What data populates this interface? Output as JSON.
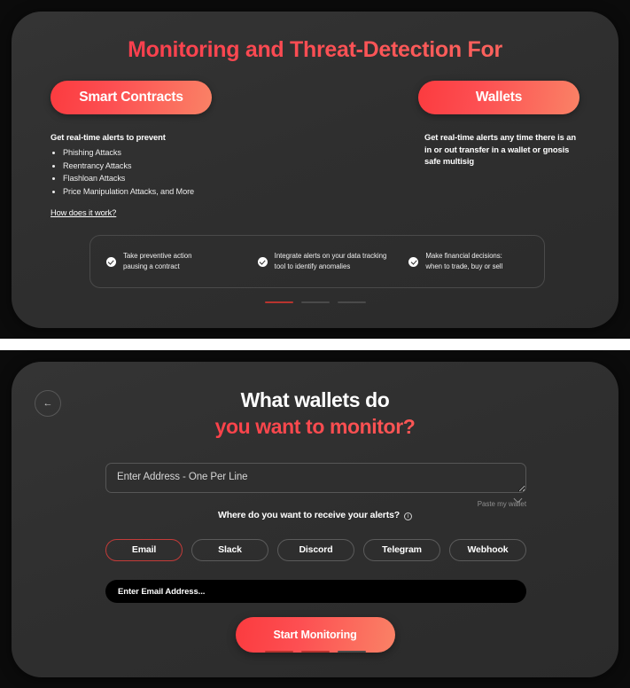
{
  "panel1": {
    "hero_title": "Monitoring and Threat-Detection For",
    "columns": [
      {
        "button_label": "Smart Contracts",
        "lead": "Get real-time alerts to prevent",
        "bullets": [
          "Phishing Attacks",
          "Reentrancy Attacks",
          "Flashloan Attacks",
          "Price Manipulation Attacks, and More"
        ],
        "link_label": "How does it work?"
      },
      {
        "button_label": "Wallets",
        "lead": "Get real-time alerts any time there is an in or out transfer in a wallet or gnosis safe multisig"
      }
    ],
    "features": [
      {
        "icon": "check-circle-icon",
        "line1": "Take preventive action",
        "line2": "pausing a contract"
      },
      {
        "icon": "check-circle-icon",
        "line1": "Integrate alerts on your data tracking",
        "line2": "tool to identify anomalies"
      },
      {
        "icon": "check-circle-icon",
        "line1": "Make financial decisions:",
        "line2": "when to trade, buy or sell"
      }
    ],
    "pagination": {
      "total": 3,
      "active_index": 0
    }
  },
  "panel2": {
    "back_icon": "arrow-left-icon",
    "back_glyph": "←",
    "title_line1": "What wallets do",
    "title_line2": "you want to monitor?",
    "address_placeholder": "Enter Address - One Per Line",
    "address_value": "",
    "paste_link": "Paste my wallet",
    "alerts_question": "Where do you want to receive your alerts?",
    "info_icon": "info-circle-icon",
    "info_glyph": "i",
    "channels": [
      {
        "label": "Email",
        "selected": true
      },
      {
        "label": "Slack",
        "selected": false
      },
      {
        "label": "Discord",
        "selected": false
      },
      {
        "label": "Telegram",
        "selected": false
      },
      {
        "label": "Webhook",
        "selected": false
      }
    ],
    "email_placeholder": "Enter Email Address...",
    "email_value": "",
    "cta_label": "Start Monitoring",
    "pagination": {
      "total": 3,
      "active_count": 2
    }
  },
  "colors": {
    "accent_red": "#fb3b3f",
    "accent_salmon": "#fa8266",
    "panel_bg": "#2f2f2f",
    "outer_bg": "#0b0b0b",
    "chip_selected_border": "#c43b39",
    "dash_active": "#b8342f",
    "dash_inactive": "#4a4a4a"
  }
}
